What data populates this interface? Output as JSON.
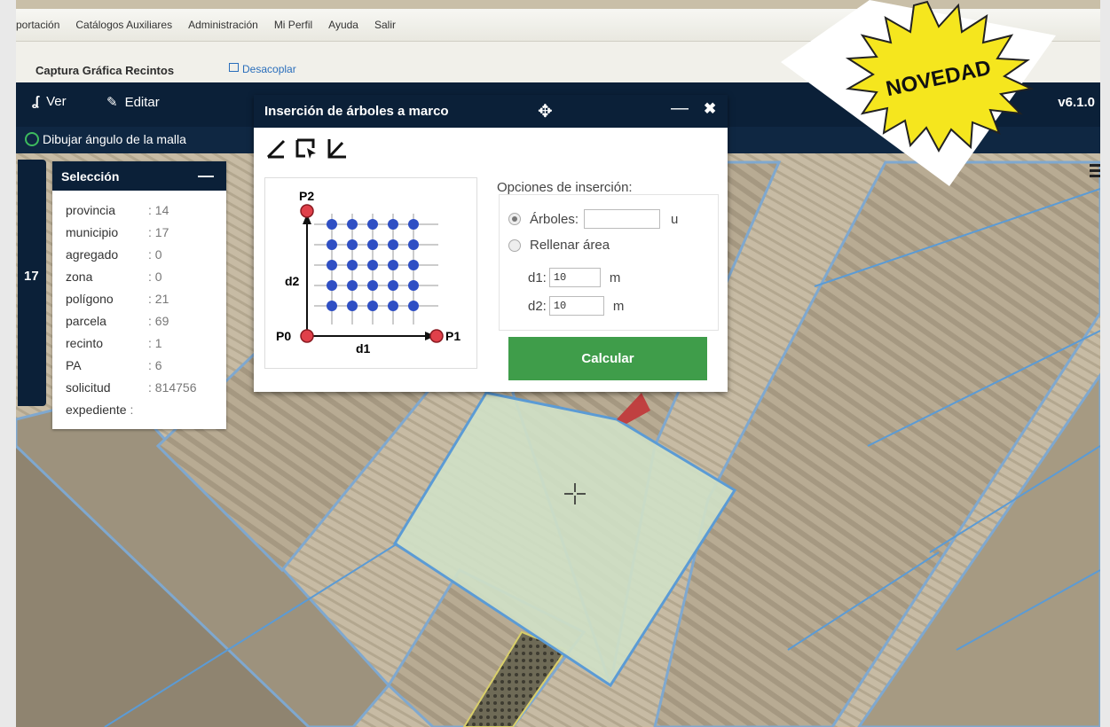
{
  "menu": {
    "items": [
      "xportación",
      "Catálogos Auxiliares",
      "Administración",
      "Mi Perfil",
      "Ayuda",
      "Salir"
    ]
  },
  "subheader": {
    "title": "Captura Gráfica Recintos",
    "undock_label": "Desacoplar"
  },
  "toolbar": {
    "view_label": "Ver",
    "edit_label": "Editar",
    "version": "v6.1.0"
  },
  "status": {
    "mode_label": "Dibujar ángulo de la malla"
  },
  "side_tab": {
    "number": "17"
  },
  "selection": {
    "title": "Selección",
    "minimize_symbol": "—",
    "fields": [
      {
        "label": "provincia",
        "value": ": 14"
      },
      {
        "label": "municipio",
        "value": ": 17"
      },
      {
        "label": "agregado",
        "value": ": 0"
      },
      {
        "label": "zona",
        "value": ": 0"
      },
      {
        "label": "polígono",
        "value": ": 21"
      },
      {
        "label": "parcela",
        "value": ": 69"
      },
      {
        "label": "recinto",
        "value": ": 1"
      },
      {
        "label": "PA",
        "value": ": 6"
      },
      {
        "label": "solicitud",
        "value": ": 814756"
      },
      {
        "label": "expediente",
        "value": ":"
      }
    ]
  },
  "dialog": {
    "title": "Inserción de árboles a marco",
    "minimize_symbol": "—",
    "close_symbol": "✖",
    "move_symbol": "✥",
    "diagram_labels": {
      "p0": "P0",
      "p1": "P1",
      "p2": "P2",
      "d1": "d1",
      "d2": "d2"
    },
    "options_title": "Opciones de inserción:",
    "trees_label": "Árboles:",
    "trees_value": "",
    "trees_unit": "u",
    "fill_label": "Rellenar área",
    "d1_label": "d1:",
    "d1_value": "10",
    "d2_label": "d2:",
    "d2_value": "10",
    "meter_unit": "m",
    "calc_label": "Calcular"
  },
  "badge": {
    "text": "NOVEDAD"
  },
  "colors": {
    "navy": "#0b2038",
    "green": "#3f9d4a",
    "parcel_blue": "#5b9bd5",
    "badge_yellow": "#f5e61e"
  },
  "icons": [
    "undock-icon",
    "ver-icon",
    "pencil-icon",
    "move-icon",
    "draw-angle-icon",
    "select-frame-icon",
    "axis-icon",
    "hamburger-icon",
    "crosshair-icon"
  ]
}
